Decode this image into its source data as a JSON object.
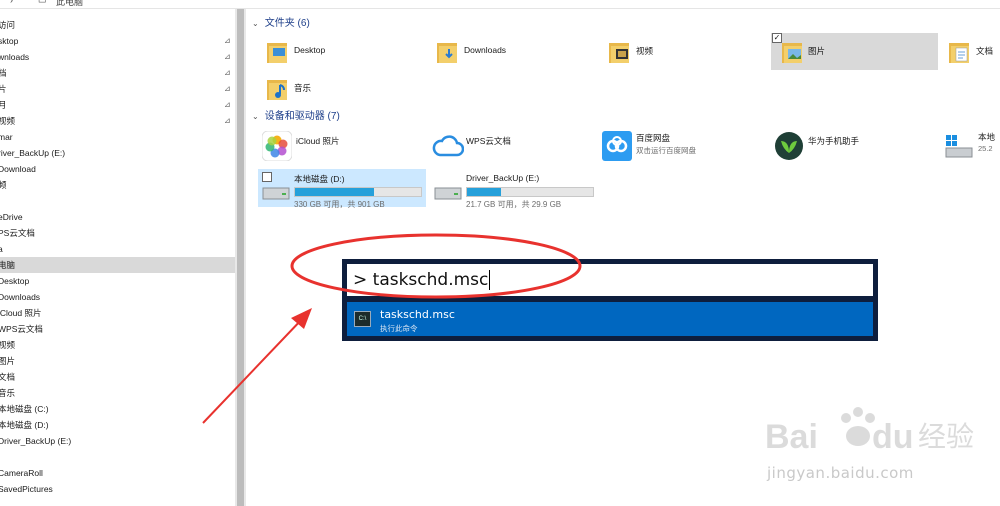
{
  "topbar": {
    "path": "此电脑"
  },
  "sidebar": {
    "items": [
      {
        "label": "访问",
        "pinned": false
      },
      {
        "label": "sktop",
        "pinned": true
      },
      {
        "label": "wnloads",
        "pinned": true
      },
      {
        "label": "档",
        "pinned": true
      },
      {
        "label": "片",
        "pinned": true
      },
      {
        "label": "月",
        "pinned": true
      },
      {
        "label": "视频",
        "pinned": true
      },
      {
        "label": "mar",
        "pinned": false
      },
      {
        "label": "river_BackUp (E:)",
        "pinned": false
      },
      {
        "label": "Download",
        "pinned": false
      },
      {
        "label": "频",
        "pinned": false
      },
      {
        "label": "",
        "pinned": false
      },
      {
        "label": "eDrive",
        "pinned": false
      },
      {
        "label": "PS云文档",
        "pinned": false
      },
      {
        "label": "a",
        "pinned": false
      },
      {
        "label": "电脑",
        "pinned": false,
        "selected": true
      },
      {
        "label": "Desktop",
        "pinned": false
      },
      {
        "label": "Downloads",
        "pinned": false
      },
      {
        "label": "iCloud 照片",
        "pinned": false
      },
      {
        "label": "WPS云文档",
        "pinned": false
      },
      {
        "label": "视频",
        "pinned": false
      },
      {
        "label": "图片",
        "pinned": false
      },
      {
        "label": "文档",
        "pinned": false
      },
      {
        "label": "音乐",
        "pinned": false
      },
      {
        "label": "本地磁盘 (C:)",
        "pinned": false
      },
      {
        "label": "本地磁盘 (D:)",
        "pinned": false
      },
      {
        "label": "Driver_BackUp (E:)",
        "pinned": false
      },
      {
        "label": "",
        "pinned": false
      },
      {
        "label": "CameraRoll",
        "pinned": false
      },
      {
        "label": "SavedPictures",
        "pinned": false
      }
    ],
    "pin_glyph": "📌"
  },
  "folders_section": {
    "header": "文件夹 (6)"
  },
  "folders": [
    {
      "label": "Desktop",
      "icon": "desktop-folder-icon"
    },
    {
      "label": "Downloads",
      "icon": "downloads-folder-icon"
    },
    {
      "label": "视频",
      "icon": "videos-folder-icon"
    },
    {
      "label": "图片",
      "icon": "pictures-folder-icon",
      "state": "selected"
    },
    {
      "label": "文档",
      "icon": "documents-folder-icon"
    },
    {
      "label": "音乐",
      "icon": "music-folder-icon"
    }
  ],
  "devices_section": {
    "header": "设备和驱动器 (7)"
  },
  "devices": [
    {
      "name": "iCloud 照片",
      "sub": "",
      "icon": "icloud-photos-icon"
    },
    {
      "name": "WPS云文档",
      "sub": "",
      "icon": "wps-cloud-icon"
    },
    {
      "name": "百度网盘",
      "sub": "双击运行百度网盘",
      "icon": "baidu-netdisk-icon"
    },
    {
      "name": "华为手机助手",
      "sub": "",
      "icon": "huawei-assistant-icon"
    },
    {
      "name": "本地",
      "sub": "25.2",
      "icon": "windows-drive-icon"
    }
  ],
  "drives": [
    {
      "name": "本地磁盘 (D:)",
      "size": "330 GB 可用，共 901 GB",
      "used_fraction": 0.63
    },
    {
      "name": "Driver_BackUp (E:)",
      "size": "21.7 GB 可用，共 29.9 GB",
      "used_fraction": 0.27
    }
  ],
  "run_dialog": {
    "input_value": "> taskschd.msc",
    "result_title": "taskschd.msc",
    "result_sub": "执行此命令",
    "result_icon_text": "C:\\"
  },
  "watermark": {
    "url": "jingyan.baidu.com"
  },
  "colors": {
    "accent": "#0067c0",
    "annotation": "#e8322e",
    "header_blue": "#1e3f8a"
  }
}
